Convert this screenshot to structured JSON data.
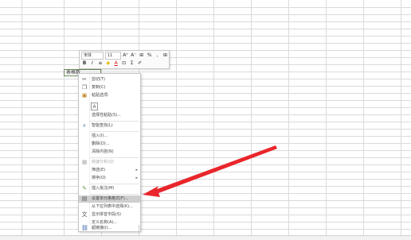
{
  "cell": {
    "text": "表格数"
  },
  "mini_toolbar": {
    "font_name": "宋体",
    "font_size": "11",
    "grow_font": "A⁺",
    "shrink_font": "A⁻",
    "format_symbol": "⊞",
    "percent": "%",
    "thousands": ",",
    "bold": "B",
    "italic": "I",
    "align": "≡",
    "fill": "◆",
    "font_color": "A",
    "border": "⊡",
    "merge": "⊞",
    "sum": "Σ",
    "format_painter": "✐"
  },
  "context_menu": {
    "items": [
      {
        "label": "剪切(T)",
        "icon": "scissors-icon",
        "glyph": "✂",
        "disabled": false,
        "submenu": false
      },
      {
        "label": "复制(C)",
        "icon": "copy-icon",
        "glyph": "❐",
        "disabled": false,
        "submenu": false
      },
      {
        "label": "粘贴选项:",
        "icon": "paste-icon",
        "glyph": "📋",
        "disabled": false,
        "submenu": false
      },
      {
        "label": "",
        "icon": "paste-option-icon",
        "glyph": "",
        "disabled": false,
        "submenu": false
      },
      {
        "label": "选择性粘贴(S)...",
        "icon": "",
        "glyph": "",
        "disabled": false,
        "submenu": false
      },
      {
        "label": "智能查找(L)",
        "icon": "search-icon",
        "glyph": "⌕",
        "disabled": false,
        "submenu": false
      },
      {
        "label": "插入(I)...",
        "icon": "",
        "glyph": "",
        "disabled": false,
        "submenu": false
      },
      {
        "label": "删除(D)...",
        "icon": "",
        "glyph": "",
        "disabled": false,
        "submenu": false
      },
      {
        "label": "清除内容(N)",
        "icon": "",
        "glyph": "",
        "disabled": false,
        "submenu": false
      },
      {
        "label": "快速分析(Q)",
        "icon": "quick-analysis-icon",
        "glyph": "▦",
        "disabled": true,
        "submenu": false
      },
      {
        "label": "筛选(E)",
        "icon": "",
        "glyph": "",
        "disabled": false,
        "submenu": true
      },
      {
        "label": "排序(O)",
        "icon": "",
        "glyph": "",
        "disabled": false,
        "submenu": true
      },
      {
        "label": "插入批注(M)",
        "icon": "comment-icon",
        "glyph": "✎",
        "disabled": false,
        "submenu": false
      },
      {
        "label": "设置单元格格式(F)...",
        "icon": "format-cells-icon",
        "glyph": "▤",
        "disabled": false,
        "submenu": false,
        "selected": true
      },
      {
        "label": "从下拉列表中选择(K)...",
        "icon": "",
        "glyph": "",
        "disabled": false,
        "submenu": false
      },
      {
        "label": "显示拼音字段(S)",
        "icon": "phonetic-icon",
        "glyph": "文",
        "disabled": false,
        "submenu": false
      },
      {
        "label": "定义名称(A)...",
        "icon": "",
        "glyph": "",
        "disabled": false,
        "submenu": false
      },
      {
        "label": "超链接(I)...",
        "icon": "hyperlink-icon",
        "glyph": "⛓",
        "disabled": false,
        "submenu": false
      }
    ]
  },
  "colors": {
    "arrow": "#e8262b",
    "highlight": "#cfcfcf",
    "grid": "#dadada"
  }
}
